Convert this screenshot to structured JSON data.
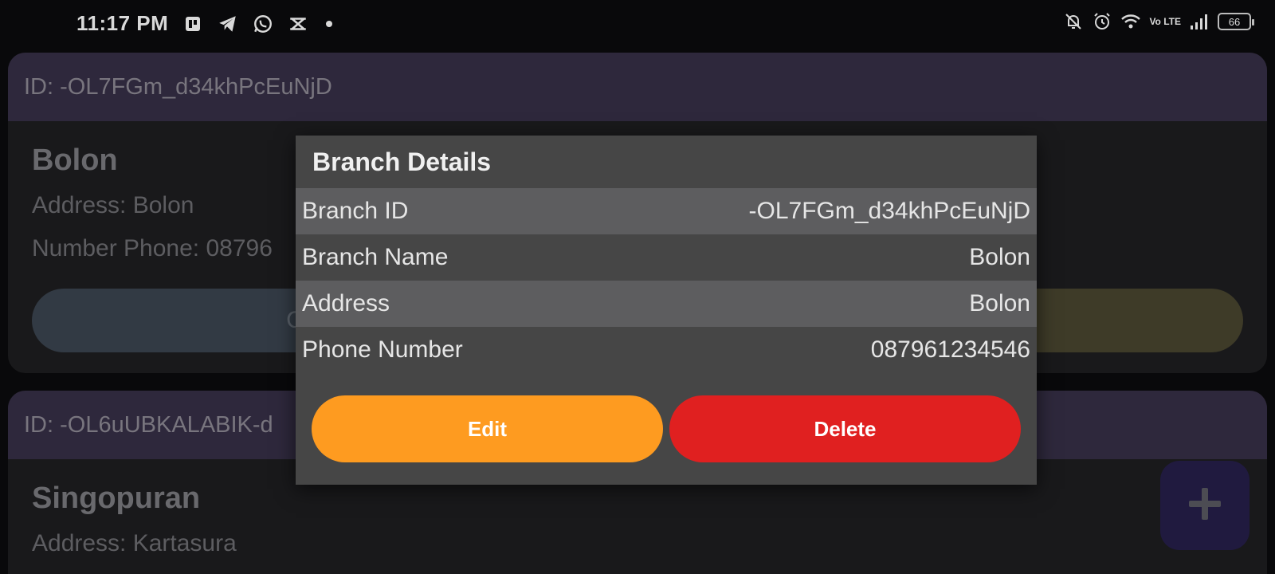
{
  "status_bar": {
    "time": "11:17 PM",
    "battery": "66",
    "network": "Vo LTE"
  },
  "cards": [
    {
      "id": "ID: -OL7FGm_d34khPcEuNjD",
      "name": "Bolon",
      "address": "Address: Bolon",
      "phone": "Number Phone: 08796",
      "left_button": "C"
    },
    {
      "id": "ID: -OL6uUBKALABIK-d",
      "name": "Singopuran",
      "address": "Address: Kartasura"
    }
  ],
  "dialog": {
    "title": "Branch Details",
    "rows": [
      {
        "label": "Branch ID",
        "value": "-OL7FGm_d34khPcEuNjD"
      },
      {
        "label": "Branch Name",
        "value": "Bolon"
      },
      {
        "label": "Address",
        "value": "Bolon"
      },
      {
        "label": "Phone Number",
        "value": "087961234546"
      }
    ],
    "edit_label": "Edit",
    "delete_label": "Delete"
  },
  "colors": {
    "edit": "#fe9b20",
    "delete": "#e02020",
    "card_header": "#372f47"
  },
  "icons": [
    "pinned-app-icon",
    "telegram-icon",
    "whatsapp-icon",
    "capcut-icon",
    "bell-off-icon",
    "alarm-icon",
    "wifi-icon",
    "signal-icon",
    "battery-icon",
    "plus-icon"
  ]
}
